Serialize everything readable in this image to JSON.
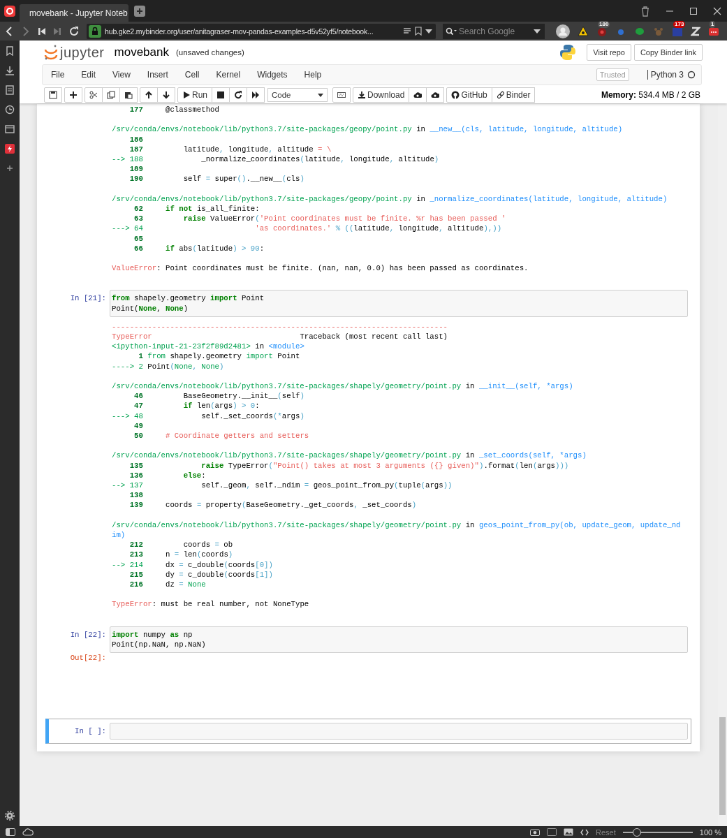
{
  "browser": {
    "tab_title": "movebank - Jupyter Noteb",
    "url": "hub.gke2.mybinder.org/user/anitagraser-mov-pandas-examples-d5v52yf5/notebook...",
    "search": {
      "placeholder": "Search Google"
    },
    "badges": [
      "180",
      "173",
      "1"
    ],
    "zoom": {
      "reset": "Reset",
      "level": 0.2,
      "reading": "100 %"
    }
  },
  "notebook": {
    "logo": "jupyter",
    "name": "movebank",
    "save_status": "(unsaved changes)",
    "header_buttons": [
      "Visit repo",
      "Copy Binder link"
    ],
    "menu": [
      "File",
      "Edit",
      "View",
      "Insert",
      "Cell",
      "Kernel",
      "Widgets",
      "Help"
    ],
    "trusted": "Trusted",
    "kernel": "Python 3",
    "kernel_busy": false,
    "toolbar": {
      "run": "Run",
      "cell_type": "Code",
      "download": "Download",
      "github": "GitHub",
      "binder": "Binder",
      "memory": "**Memory:** 534.4 MB / 2 GB"
    },
    "cells": [
      {
        "kind": "output_only",
        "selected": false,
        "output": [
          [
            [
              {
                "kind": "lineno",
                "text": "    177"
              },
              {
                "kind": "plain",
                "text": "     @classmethod"
              }
            ]
          ],
          [
            [
              {
                "kind": "path",
                "text": "/srv/conda/envs/notebook/lib/python3.7/site-packages/geopy/point.py"
              },
              {
                "kind": "plain",
                "text": " in "
              },
              {
                "kind": "func",
                "text": "__new__(cls, latitude, longitude, altitude)"
              }
            ],
            [
              {
                "kind": "lineno",
                "text": "    186"
              }
            ],
            [
              {
                "kind": "lineno",
                "text": "    187"
              },
              {
                "kind": "plain",
                "text": "         latitude"
              },
              {
                "kind": "op",
                "text": ","
              },
              {
                "kind": "plain",
                "text": " longitude"
              },
              {
                "kind": "op",
                "text": ","
              },
              {
                "kind": "plain",
                "text": " altitude "
              },
              {
                "kind": "str",
                "text": "= \\"
              }
            ],
            [
              {
                "kind": "arrow",
                "text": "--> 188"
              },
              {
                "kind": "plain",
                "text": "             _normalize_coordinates"
              },
              {
                "kind": "op",
                "text": "("
              },
              {
                "kind": "plain",
                "text": "latitude"
              },
              {
                "kind": "op",
                "text": ","
              },
              {
                "kind": "plain",
                "text": " longitude"
              },
              {
                "kind": "op",
                "text": ","
              },
              {
                "kind": "plain",
                "text": " altitude"
              },
              {
                "kind": "op",
                "text": ")"
              }
            ],
            [
              {
                "kind": "lineno",
                "text": "    189"
              }
            ],
            [
              {
                "kind": "lineno",
                "text": "    190"
              },
              {
                "kind": "plain",
                "text": "         self "
              },
              {
                "kind": "op",
                "text": "="
              },
              {
                "kind": "plain",
                "text": " super"
              },
              {
                "kind": "op",
                "text": "()"
              },
              {
                "kind": "plain",
                "text": ".__new__"
              },
              {
                "kind": "op",
                "text": "("
              },
              {
                "kind": "plain",
                "text": "cls"
              },
              {
                "kind": "op",
                "text": ")"
              }
            ]
          ],
          [
            [
              {
                "kind": "path",
                "text": "/srv/conda/envs/notebook/lib/python3.7/site-packages/geopy/point.py"
              },
              {
                "kind": "plain",
                "text": " in "
              },
              {
                "kind": "func",
                "text": "_normalize_coordinates(latitude, longitude, altitude)"
              }
            ],
            [
              {
                "kind": "lineno",
                "text": "     62"
              },
              {
                "kind": "kw",
                "text": "     if"
              },
              {
                "kind": "kw",
                "text": " not"
              },
              {
                "kind": "plain",
                "text": " is_all_finite:"
              }
            ],
            [
              {
                "kind": "lineno",
                "text": "     63"
              },
              {
                "kind": "kw",
                "text": "         raise"
              },
              {
                "kind": "plain",
                "text": " ValueError"
              },
              {
                "kind": "op",
                "text": "("
              },
              {
                "kind": "str",
                "text": "'Point coordinates must be finite. %r has been passed '"
              }
            ],
            [
              {
                "kind": "arrow",
                "text": "---> 64"
              },
              {
                "kind": "str",
                "text": "                         'as coordinates.'"
              },
              {
                "kind": "op",
                "text": " % (("
              },
              {
                "kind": "plain",
                "text": "latitude"
              },
              {
                "kind": "op",
                "text": ","
              },
              {
                "kind": "plain",
                "text": " longitude"
              },
              {
                "kind": "op",
                "text": ","
              },
              {
                "kind": "plain",
                "text": " altitude"
              },
              {
                "kind": "op",
                "text": "),))"
              }
            ],
            [
              {
                "kind": "lineno",
                "text": "     65"
              }
            ],
            [
              {
                "kind": "lineno",
                "text": "     66"
              },
              {
                "kind": "kw",
                "text": "     if"
              },
              {
                "kind": "plain",
                "text": " abs"
              },
              {
                "kind": "op",
                "text": "("
              },
              {
                "kind": "plain",
                "text": "latitude"
              },
              {
                "kind": "op",
                "text": ")"
              },
              {
                "kind": "op",
                "text": " > 90"
              },
              {
                "kind": "plain",
                "text": ":"
              }
            ]
          ],
          [
            [
              {
                "kind": "err",
                "text": "ValueError"
              },
              {
                "kind": "plain",
                "text": ": Point coordinates must be finite. (nan, nan, 0.0) has been passed as coordinates."
              }
            ]
          ]
        ]
      },
      {
        "kind": "code",
        "selected": false,
        "prompt": "In [21]:",
        "input": [
          [
            {
              "kind": "kw",
              "text": "from"
            },
            {
              "kind": "plain",
              "text": " shapely.geometry "
            },
            {
              "kind": "kw",
              "text": "import"
            },
            {
              "kind": "plain",
              "text": " Point"
            }
          ],
          [
            {
              "kind": "plain",
              "text": "Point("
            },
            {
              "kind": "kw",
              "text": "None"
            },
            {
              "kind": "plain",
              "text": ", "
            },
            {
              "kind": "kw",
              "text": "None"
            },
            {
              "kind": "plain",
              "text": ")"
            }
          ]
        ],
        "output": [
          [
            [
              {
                "kind": "err",
                "text": "---------------------------------------------------------------------------"
              }
            ],
            [
              {
                "kind": "err",
                "text": "TypeError"
              },
              {
                "kind": "plain",
                "text": "                                 Traceback (most recent call last)"
              }
            ],
            [
              {
                "kind": "path",
                "text": "<ipython-input-21-23f2f89d2481>"
              },
              {
                "kind": "plain",
                "text": " in "
              },
              {
                "kind": "func",
                "text": "<module>"
              }
            ],
            [
              {
                "kind": "lineno",
                "text": "      1"
              },
              {
                "kind": "kw2",
                "text": " from"
              },
              {
                "kind": "plain",
                "text": " shapely.geometry "
              },
              {
                "kind": "kw2",
                "text": "import"
              },
              {
                "kind": "plain",
                "text": " Point"
              }
            ],
            [
              {
                "kind": "arrow",
                "text": "----> 2"
              },
              {
                "kind": "plain",
                "text": " Point"
              },
              {
                "kind": "op",
                "text": "("
              },
              {
                "kind": "kw2",
                "text": "None"
              },
              {
                "kind": "op",
                "text": ","
              },
              {
                "kind": "kw2",
                "text": " None"
              },
              {
                "kind": "op",
                "text": ")"
              }
            ]
          ],
          [
            [
              {
                "kind": "path",
                "text": "/srv/conda/envs/notebook/lib/python3.7/site-packages/shapely/geometry/point.py"
              },
              {
                "kind": "plain",
                "text": " in "
              },
              {
                "kind": "func",
                "text": "__init__(self, *args)"
              }
            ],
            [
              {
                "kind": "lineno",
                "text": "     46"
              },
              {
                "kind": "plain",
                "text": "         BaseGeometry.__init__"
              },
              {
                "kind": "op",
                "text": "("
              },
              {
                "kind": "plain",
                "text": "self"
              },
              {
                "kind": "op",
                "text": ")"
              }
            ],
            [
              {
                "kind": "lineno",
                "text": "     47"
              },
              {
                "kind": "kw",
                "text": "         if"
              },
              {
                "kind": "plain",
                "text": " len"
              },
              {
                "kind": "op",
                "text": "("
              },
              {
                "kind": "plain",
                "text": "args"
              },
              {
                "kind": "op",
                "text": ")"
              },
              {
                "kind": "op",
                "text": " > 0"
              },
              {
                "kind": "plain",
                "text": ":"
              }
            ],
            [
              {
                "kind": "arrow",
                "text": "---> 48"
              },
              {
                "kind": "plain",
                "text": "             self._set_coords"
              },
              {
                "kind": "op",
                "text": "(*"
              },
              {
                "kind": "plain",
                "text": "args"
              },
              {
                "kind": "op",
                "text": ")"
              }
            ],
            [
              {
                "kind": "lineno",
                "text": "     49"
              }
            ],
            [
              {
                "kind": "lineno",
                "text": "     50"
              },
              {
                "kind": "str",
                "text": "     # Coordinate getters and setters"
              }
            ]
          ],
          [
            [
              {
                "kind": "path",
                "text": "/srv/conda/envs/notebook/lib/python3.7/site-packages/shapely/geometry/point.py"
              },
              {
                "kind": "plain",
                "text": " in "
              },
              {
                "kind": "func",
                "text": "_set_coords(self, *args)"
              }
            ],
            [
              {
                "kind": "lineno",
                "text": "    135"
              },
              {
                "kind": "kw",
                "text": "             raise"
              },
              {
                "kind": "plain",
                "text": " TypeError"
              },
              {
                "kind": "op",
                "text": "("
              },
              {
                "kind": "str",
                "text": "\"Point() takes at most 3 arguments ({} given)\""
              },
              {
                "kind": "op",
                "text": ")"
              },
              {
                "kind": "plain",
                "text": ".format"
              },
              {
                "kind": "op",
                "text": "("
              },
              {
                "kind": "plain",
                "text": "len"
              },
              {
                "kind": "op",
                "text": "("
              },
              {
                "kind": "plain",
                "text": "args"
              },
              {
                "kind": "op",
                "text": ")))"
              }
            ],
            [
              {
                "kind": "lineno",
                "text": "    136"
              },
              {
                "kind": "kw",
                "text": "         else"
              },
              {
                "kind": "plain",
                "text": ":"
              }
            ],
            [
              {
                "kind": "arrow",
                "text": "--> 137"
              },
              {
                "kind": "plain",
                "text": "             self._geom"
              },
              {
                "kind": "op",
                "text": ","
              },
              {
                "kind": "plain",
                "text": " self._ndim "
              },
              {
                "kind": "op",
                "text": "="
              },
              {
                "kind": "plain",
                "text": " geos_point_from_py"
              },
              {
                "kind": "op",
                "text": "("
              },
              {
                "kind": "plain",
                "text": "tuple"
              },
              {
                "kind": "op",
                "text": "("
              },
              {
                "kind": "plain",
                "text": "args"
              },
              {
                "kind": "op",
                "text": "))"
              }
            ],
            [
              {
                "kind": "lineno",
                "text": "    138"
              }
            ],
            [
              {
                "kind": "lineno",
                "text": "    139"
              },
              {
                "kind": "plain",
                "text": "     coords "
              },
              {
                "kind": "op",
                "text": "="
              },
              {
                "kind": "plain",
                "text": " property"
              },
              {
                "kind": "op",
                "text": "("
              },
              {
                "kind": "plain",
                "text": "BaseGeometry._get_coords"
              },
              {
                "kind": "op",
                "text": ","
              },
              {
                "kind": "plain",
                "text": " _set_coords"
              },
              {
                "kind": "op",
                "text": ")"
              }
            ]
          ],
          [
            [
              {
                "kind": "path",
                "text": "/srv/conda/envs/notebook/lib/python3.7/site-packages/shapely/geometry/point.py"
              },
              {
                "kind": "plain",
                "text": " in "
              },
              {
                "kind": "func",
                "text": "geos_point_from_py(ob, update_geom, update_nd"
              }
            ],
            [
              {
                "kind": "func",
                "text": "im)"
              }
            ],
            [
              {
                "kind": "lineno",
                "text": "    212"
              },
              {
                "kind": "plain",
                "text": "         coords "
              },
              {
                "kind": "op",
                "text": "="
              },
              {
                "kind": "plain",
                "text": " ob"
              }
            ],
            [
              {
                "kind": "lineno",
                "text": "    213"
              },
              {
                "kind": "plain",
                "text": "     n "
              },
              {
                "kind": "op",
                "text": "="
              },
              {
                "kind": "plain",
                "text": " len"
              },
              {
                "kind": "op",
                "text": "("
              },
              {
                "kind": "plain",
                "text": "coords"
              },
              {
                "kind": "op",
                "text": ")"
              }
            ],
            [
              {
                "kind": "arrow",
                "text": "--> 214"
              },
              {
                "kind": "plain",
                "text": "     dx "
              },
              {
                "kind": "op",
                "text": "="
              },
              {
                "kind": "plain",
                "text": " c_double"
              },
              {
                "kind": "op",
                "text": "("
              },
              {
                "kind": "plain",
                "text": "coords"
              },
              {
                "kind": "op",
                "text": "[0])"
              }
            ],
            [
              {
                "kind": "lineno",
                "text": "    215"
              },
              {
                "kind": "plain",
                "text": "     dy "
              },
              {
                "kind": "op",
                "text": "="
              },
              {
                "kind": "plain",
                "text": " c_double"
              },
              {
                "kind": "op",
                "text": "("
              },
              {
                "kind": "plain",
                "text": "coords"
              },
              {
                "kind": "op",
                "text": "[1])"
              }
            ],
            [
              {
                "kind": "lineno",
                "text": "    216"
              },
              {
                "kind": "plain",
                "text": "     dz "
              },
              {
                "kind": "op",
                "text": "="
              },
              {
                "kind": "kw2",
                "text": " None"
              }
            ]
          ],
          [
            [
              {
                "kind": "err",
                "text": "TypeError"
              },
              {
                "kind": "plain",
                "text": ": must be real number, not NoneType"
              }
            ]
          ]
        ]
      },
      {
        "kind": "code",
        "selected": false,
        "prompt": "In [22]:",
        "input": [
          [
            {
              "kind": "kw",
              "text": "import"
            },
            {
              "kind": "plain",
              "text": " numpy "
            },
            {
              "kind": "kw",
              "text": "as"
            },
            {
              "kind": "plain",
              "text": " np"
            }
          ],
          [
            {
              "kind": "plain",
              "text": "Point(np.NaN, np.NaN)"
            }
          ]
        ],
        "out_prompt": "Out[22]:"
      },
      {
        "kind": "code",
        "selected": true,
        "prompt": "In [ ]:"
      }
    ]
  }
}
